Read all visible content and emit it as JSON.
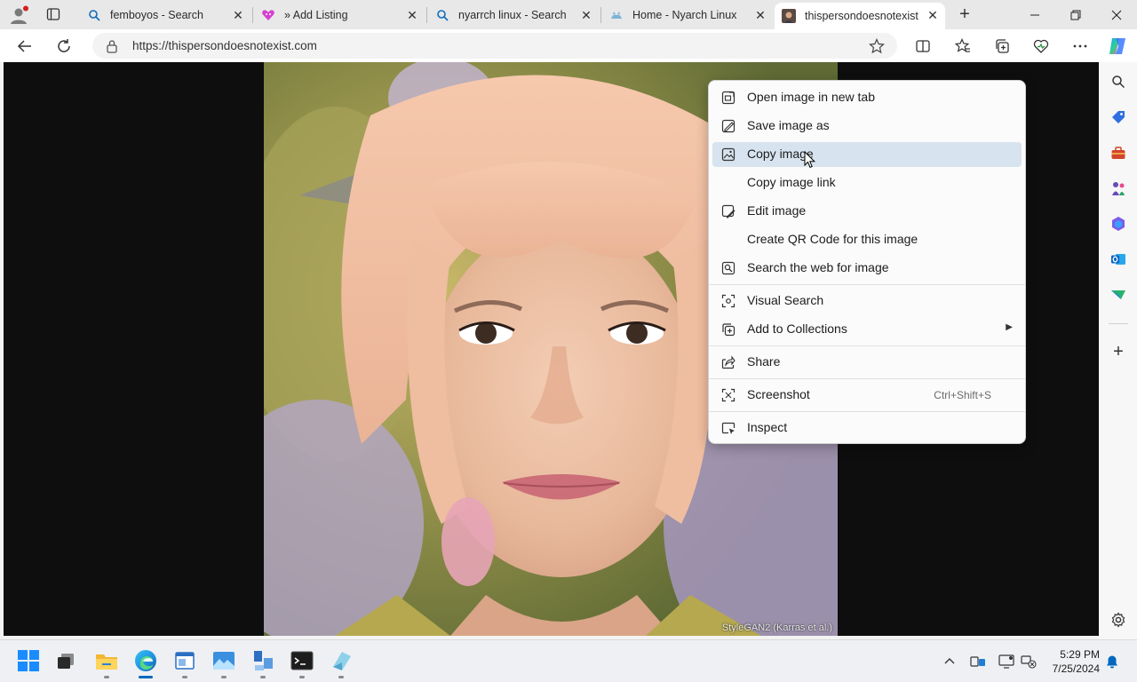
{
  "tabs": [
    {
      "title": "femboyos - Search"
    },
    {
      "title": "» Add Listing"
    },
    {
      "title": "nyarrch linux - Search"
    },
    {
      "title": "Home - Nyarch Linux"
    },
    {
      "title": "thispersondoesnotexist.c"
    }
  ],
  "address_bar": {
    "url": "https://thispersondoesnotexist.com"
  },
  "image": {
    "credit": "StyleGAN2 (Karras et al.)"
  },
  "context_menu": {
    "items": [
      {
        "label": "Open image in new tab",
        "icon": "open-new-tab-icon"
      },
      {
        "label": "Save image as",
        "icon": "save-image-icon"
      },
      {
        "label": "Copy image",
        "icon": "copy-image-icon"
      },
      {
        "label": "Copy image link"
      },
      {
        "label": "Edit image",
        "icon": "edit-image-icon"
      },
      {
        "label": "Create QR Code for this image"
      },
      {
        "label": "Search the web for image",
        "icon": "search-image-icon"
      },
      {
        "label": "Visual Search",
        "icon": "visual-search-icon"
      },
      {
        "label": "Add to Collections",
        "icon": "collections-icon"
      },
      {
        "label": "Share",
        "icon": "share-icon"
      },
      {
        "label": "Screenshot",
        "icon": "screenshot-icon",
        "shortcut": "Ctrl+Shift+S"
      },
      {
        "label": "Inspect",
        "icon": "inspect-icon"
      }
    ],
    "hovered": "Copy image"
  },
  "taskbar": {
    "clock": {
      "time": "5:29 PM",
      "date": "7/25/2024"
    }
  },
  "colors": {
    "accent": "#0067c0",
    "menu_hover": "#d7e3ee",
    "tab_bar": "#e8e8e8"
  }
}
